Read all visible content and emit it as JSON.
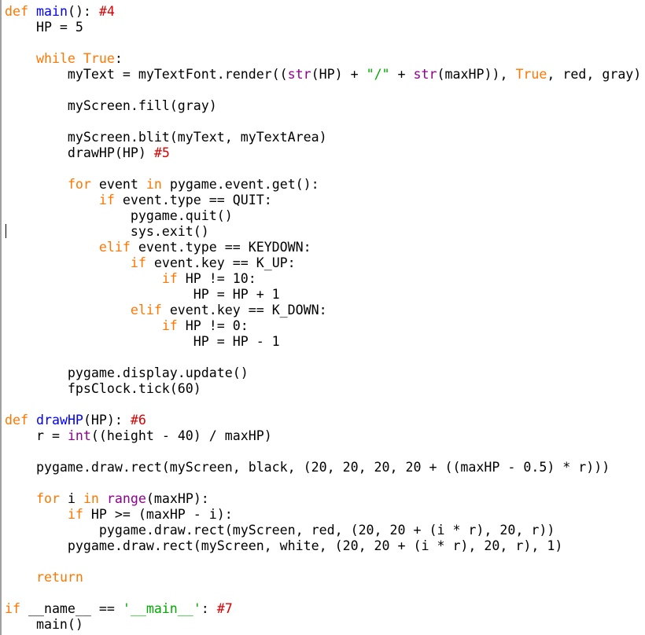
{
  "editor": {
    "language": "python",
    "colors": {
      "keyword": "#ff7700",
      "definition": "#0000ff",
      "builtin": "#900090",
      "string": "#00aa00",
      "comment": "#dd0000",
      "text": "#000000",
      "background": "#ffffff"
    },
    "caret_line": 15,
    "lines": [
      [
        {
          "t": "kw",
          "v": "def"
        },
        {
          "t": "",
          "v": " "
        },
        {
          "t": "def",
          "v": "main"
        },
        {
          "t": "",
          "v": "(): "
        },
        {
          "t": "comment",
          "v": "#4"
        }
      ],
      [
        {
          "t": "",
          "v": "    HP = 5"
        }
      ],
      [],
      [
        {
          "t": "",
          "v": "    "
        },
        {
          "t": "kw",
          "v": "while"
        },
        {
          "t": "",
          "v": " "
        },
        {
          "t": "kw",
          "v": "True"
        },
        {
          "t": "",
          "v": ":"
        }
      ],
      [
        {
          "t": "",
          "v": "        myText = myTextFont.render(("
        },
        {
          "t": "builtin",
          "v": "str"
        },
        {
          "t": "",
          "v": "(HP) + "
        },
        {
          "t": "str",
          "v": "\"/\""
        },
        {
          "t": "",
          "v": " + "
        },
        {
          "t": "builtin",
          "v": "str"
        },
        {
          "t": "",
          "v": "(maxHP)), "
        },
        {
          "t": "kw",
          "v": "True"
        },
        {
          "t": "",
          "v": ", red, gray)"
        }
      ],
      [],
      [
        {
          "t": "",
          "v": "        myScreen.fill(gray)"
        }
      ],
      [],
      [
        {
          "t": "",
          "v": "        myScreen.blit(myText, myTextArea)"
        }
      ],
      [
        {
          "t": "",
          "v": "        drawHP(HP) "
        },
        {
          "t": "comment",
          "v": "#5"
        }
      ],
      [],
      [
        {
          "t": "",
          "v": "        "
        },
        {
          "t": "kw",
          "v": "for"
        },
        {
          "t": "",
          "v": " event "
        },
        {
          "t": "kw",
          "v": "in"
        },
        {
          "t": "",
          "v": " pygame.event.get():"
        }
      ],
      [
        {
          "t": "",
          "v": "            "
        },
        {
          "t": "kw",
          "v": "if"
        },
        {
          "t": "",
          "v": " event.type == QUIT:"
        }
      ],
      [
        {
          "t": "",
          "v": "                pygame.quit()"
        }
      ],
      [
        {
          "t": "",
          "v": "                sys.exit()"
        }
      ],
      [
        {
          "t": "",
          "v": "            "
        },
        {
          "t": "kw",
          "v": "elif"
        },
        {
          "t": "",
          "v": " event.type == KEYDOWN:"
        }
      ],
      [
        {
          "t": "",
          "v": "                "
        },
        {
          "t": "kw",
          "v": "if"
        },
        {
          "t": "",
          "v": " event.key == K_UP:"
        }
      ],
      [
        {
          "t": "",
          "v": "                    "
        },
        {
          "t": "kw",
          "v": "if"
        },
        {
          "t": "",
          "v": " HP != 10:"
        }
      ],
      [
        {
          "t": "",
          "v": "                        HP = HP + 1"
        }
      ],
      [
        {
          "t": "",
          "v": "                "
        },
        {
          "t": "kw",
          "v": "elif"
        },
        {
          "t": "",
          "v": " event.key == K_DOWN:"
        }
      ],
      [
        {
          "t": "",
          "v": "                    "
        },
        {
          "t": "kw",
          "v": "if"
        },
        {
          "t": "",
          "v": " HP != 0:"
        }
      ],
      [
        {
          "t": "",
          "v": "                        HP = HP - 1"
        }
      ],
      [],
      [
        {
          "t": "",
          "v": "        pygame.display.update()"
        }
      ],
      [
        {
          "t": "",
          "v": "        fpsClock.tick(60)"
        }
      ],
      [],
      [
        {
          "t": "kw",
          "v": "def"
        },
        {
          "t": "",
          "v": " "
        },
        {
          "t": "def",
          "v": "drawHP"
        },
        {
          "t": "",
          "v": "(HP): "
        },
        {
          "t": "comment",
          "v": "#6"
        }
      ],
      [
        {
          "t": "",
          "v": "    r = "
        },
        {
          "t": "builtin",
          "v": "int"
        },
        {
          "t": "",
          "v": "((height - 40) / maxHP)"
        }
      ],
      [],
      [
        {
          "t": "",
          "v": "    pygame.draw.rect(myScreen, black, (20, 20, 20, 20 + ((maxHP - 0.5) * r)))"
        }
      ],
      [],
      [
        {
          "t": "",
          "v": "    "
        },
        {
          "t": "kw",
          "v": "for"
        },
        {
          "t": "",
          "v": " i "
        },
        {
          "t": "kw",
          "v": "in"
        },
        {
          "t": "",
          "v": " "
        },
        {
          "t": "builtin",
          "v": "range"
        },
        {
          "t": "",
          "v": "(maxHP):"
        }
      ],
      [
        {
          "t": "",
          "v": "        "
        },
        {
          "t": "kw",
          "v": "if"
        },
        {
          "t": "",
          "v": " HP >= (maxHP - i):"
        }
      ],
      [
        {
          "t": "",
          "v": "            pygame.draw.rect(myScreen, red, (20, 20 + (i * r), 20, r))"
        }
      ],
      [
        {
          "t": "",
          "v": "        pygame.draw.rect(myScreen, white, (20, 20 + (i * r), 20, r), 1)"
        }
      ],
      [],
      [
        {
          "t": "",
          "v": "    "
        },
        {
          "t": "kw",
          "v": "return"
        }
      ],
      [],
      [
        {
          "t": "kw",
          "v": "if"
        },
        {
          "t": "",
          "v": " __name__ == "
        },
        {
          "t": "str",
          "v": "'__main__'"
        },
        {
          "t": "",
          "v": ": "
        },
        {
          "t": "comment",
          "v": "#7"
        }
      ],
      [
        {
          "t": "",
          "v": "    main()"
        }
      ]
    ]
  }
}
